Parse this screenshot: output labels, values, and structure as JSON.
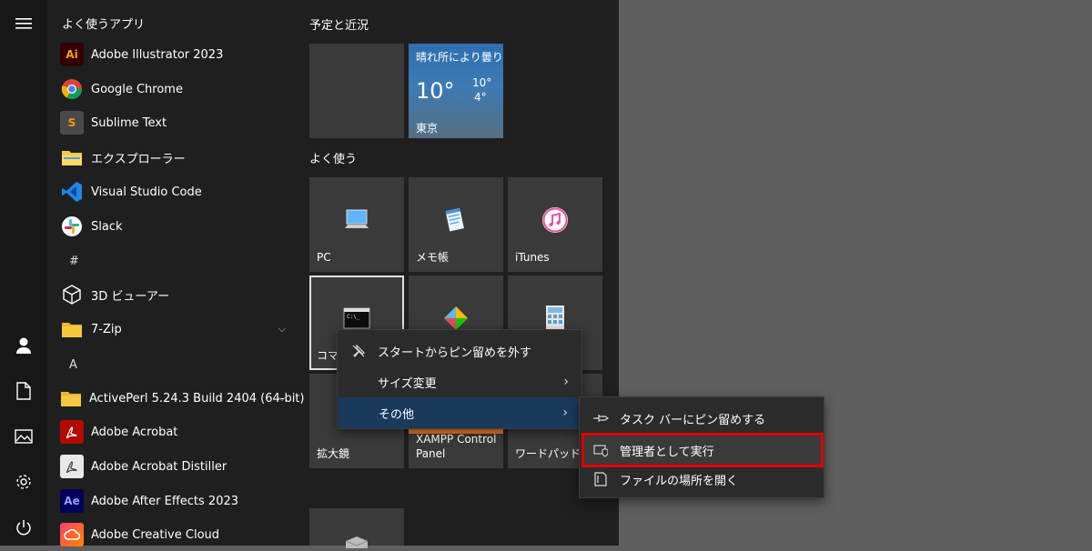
{
  "rail": {
    "items": [
      "hamburger-menu",
      "user-account",
      "documents",
      "pictures",
      "settings",
      "power"
    ]
  },
  "app_list": {
    "section_title": "よく使うアプリ",
    "frequent": [
      {
        "label": "Adobe Illustrator 2023",
        "icon": "illustrator-icon",
        "badge": "Ai"
      },
      {
        "label": "Google Chrome",
        "icon": "chrome-icon"
      },
      {
        "label": "Sublime Text",
        "icon": "sublime-icon",
        "badge": "S"
      },
      {
        "label": "エクスプローラー",
        "icon": "folder-icon"
      },
      {
        "label": "Visual Studio Code",
        "icon": "vscode-icon"
      },
      {
        "label": "Slack",
        "icon": "slack-icon"
      }
    ],
    "letter_hash": "#",
    "hash_items": [
      {
        "label": "3D ビューアー",
        "icon": "cube-icon"
      },
      {
        "label": "7-Zip",
        "icon": "folder-icon"
      }
    ],
    "letter_a": "A",
    "a_items": [
      {
        "label": "ActivePerl 5.24.3 Build 2404 (64-bit)",
        "icon": "folder-icon"
      },
      {
        "label": "Adobe Acrobat",
        "icon": "acrobat-icon"
      },
      {
        "label": "Adobe Acrobat Distiller",
        "icon": "distiller-icon"
      },
      {
        "label": "Adobe After Effects 2023",
        "icon": "after-effects-icon",
        "badge": "Ae"
      },
      {
        "label": "Adobe Creative Cloud",
        "icon": "creative-cloud-icon"
      }
    ]
  },
  "tiles": {
    "group1_title": "予定と近況",
    "weather": {
      "condition": "晴れ所により曇り",
      "temp": "10°",
      "high": "10°",
      "low": "4°",
      "city": "東京"
    },
    "group2_title": "よく使う",
    "items": [
      {
        "label": "PC",
        "icon": "pc-icon"
      },
      {
        "label": "メモ帳",
        "icon": "notepad-icon"
      },
      {
        "label": "iTunes",
        "icon": "itunes-icon"
      },
      {
        "label": "コマンド",
        "icon": "cmd-icon"
      },
      {
        "label": "",
        "icon": "paint3d-icon"
      },
      {
        "label": "",
        "icon": "calculator-icon"
      },
      {
        "label": "拡大鏡",
        "icon": "magnifier-icon"
      },
      {
        "label": "XAMPP Control Panel",
        "icon": "xampp-icon"
      },
      {
        "label": "ワードパッド",
        "icon": "wordpad-icon"
      }
    ]
  },
  "context_menu": {
    "items": [
      {
        "label": "スタートからピン留めを外す",
        "icon": "unpin-icon"
      },
      {
        "label": "サイズ変更",
        "icon": ""
      },
      {
        "label": "その他",
        "icon": ""
      }
    ]
  },
  "submenu": {
    "items": [
      {
        "label": "タスク バーにピン留めする",
        "icon": "pin-icon"
      },
      {
        "label": "管理者として実行",
        "icon": "shield-icon"
      },
      {
        "label": "ファイルの場所を開く",
        "icon": "file-location-icon"
      }
    ],
    "highlight_color": "#e00000"
  }
}
